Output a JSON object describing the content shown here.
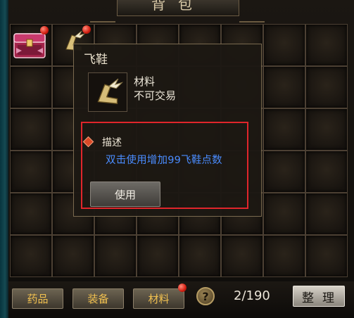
{
  "window": {
    "title": "背包"
  },
  "inventory": {
    "columns": 8,
    "rows": 6,
    "items": [
      {
        "name": "chest",
        "icon": "treasure-chest-icon"
      },
      {
        "name": "飞鞋",
        "icon": "winged-boots-icon"
      }
    ]
  },
  "tooltip": {
    "item_name": "飞鞋",
    "type": "材料",
    "tradeable": "不可交易",
    "desc_label": "描述",
    "desc_text": "双击使用增加99飞鞋点数",
    "use_button": "使用"
  },
  "bottom_bar": {
    "tabs": [
      "药品",
      "装备",
      "材料"
    ],
    "help": "?",
    "count": "2/190",
    "sort_button": "整理"
  },
  "colors": {
    "desc_text": "#4a8cff",
    "highlight_box": "#e0252b",
    "tab_text": "#f0c050"
  }
}
